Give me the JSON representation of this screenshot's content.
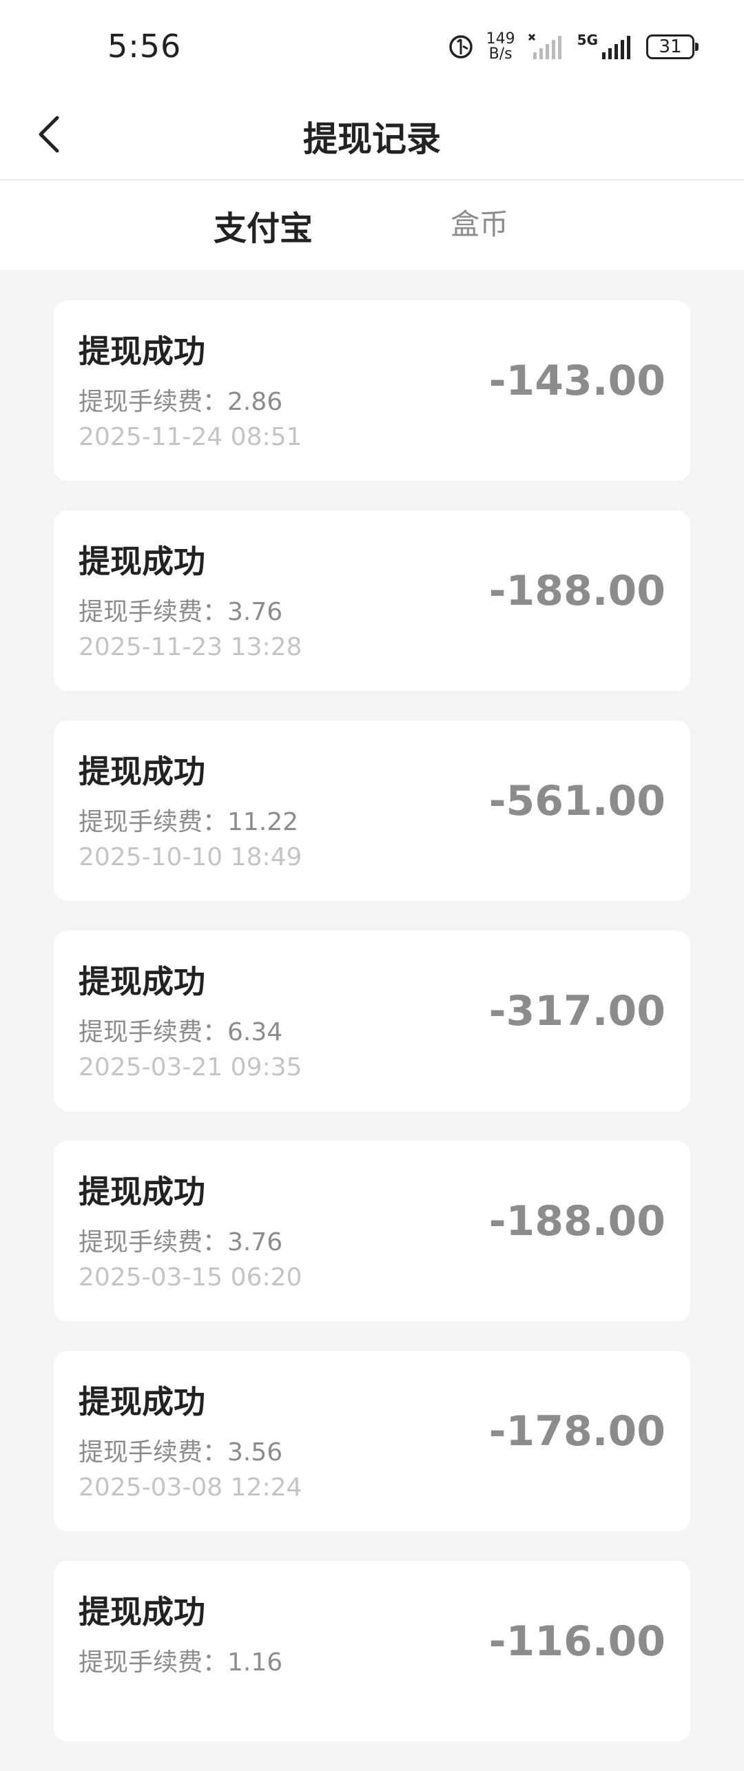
{
  "status_bar": {
    "time": "5:56",
    "net_speed_value": "149",
    "net_speed_unit": "B/s",
    "network": "5G",
    "battery": "31"
  },
  "header": {
    "title": "提现记录",
    "back_icon": "chevron-left-icon"
  },
  "tabs": [
    {
      "label": "支付宝",
      "active": true
    },
    {
      "label": "盒币",
      "active": false
    }
  ],
  "accent_gradient": [
    "#ffb400",
    "#ff6a00"
  ],
  "records": [
    {
      "status": "提现成功",
      "fee_label": "提现手续费：",
      "fee": "2.86",
      "time": "2025-11-24 08:51",
      "amount": "-143.00"
    },
    {
      "status": "提现成功",
      "fee_label": "提现手续费：",
      "fee": "3.76",
      "time": "2025-11-23 13:28",
      "amount": "-188.00"
    },
    {
      "status": "提现成功",
      "fee_label": "提现手续费：",
      "fee": "11.22",
      "time": "2025-10-10 18:49",
      "amount": "-561.00"
    },
    {
      "status": "提现成功",
      "fee_label": "提现手续费：",
      "fee": "6.34",
      "time": "2025-03-21 09:35",
      "amount": "-317.00"
    },
    {
      "status": "提现成功",
      "fee_label": "提现手续费：",
      "fee": "3.76",
      "time": "2025-03-15 06:20",
      "amount": "-188.00"
    },
    {
      "status": "提现成功",
      "fee_label": "提现手续费：",
      "fee": "3.56",
      "time": "2025-03-08 12:24",
      "amount": "-178.00"
    },
    {
      "status": "提现成功",
      "fee_label": "提现手续费：",
      "fee": "1.16",
      "time": "",
      "amount": "-116.00"
    }
  ]
}
